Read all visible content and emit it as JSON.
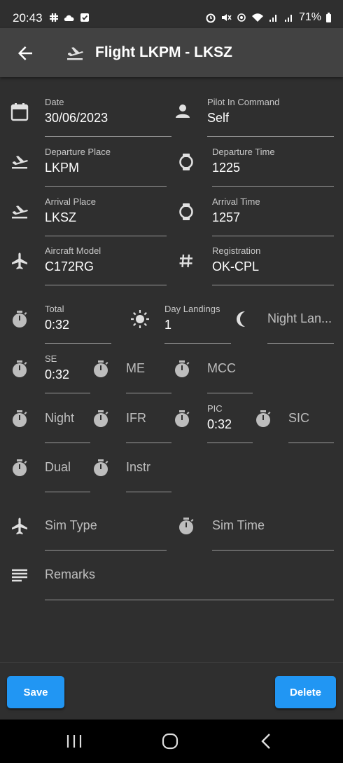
{
  "status_bar": {
    "time": "20:43",
    "battery": "71%"
  },
  "header": {
    "title": "Flight LKPM - LKSZ"
  },
  "fields": {
    "date": {
      "label": "Date",
      "value": "30/06/2023"
    },
    "pic_name": {
      "label": "Pilot In Command",
      "value": "Self"
    },
    "departure_place": {
      "label": "Departure Place",
      "value": "LKPM"
    },
    "departure_time": {
      "label": "Departure Time",
      "value": "1225"
    },
    "arrival_place": {
      "label": "Arrival Place",
      "value": "LKSZ"
    },
    "arrival_time": {
      "label": "Arrival Time",
      "value": "1257"
    },
    "aircraft_model": {
      "label": "Aircraft Model",
      "value": "C172RG"
    },
    "registration": {
      "label": "Registration",
      "value": "OK-CPL"
    },
    "total": {
      "label": "Total",
      "value": "0:32"
    },
    "day_landings": {
      "label": "Day Landings",
      "value": "1"
    },
    "night_landings": {
      "placeholder": "Night Lan..."
    },
    "se": {
      "label": "SE",
      "value": "0:32"
    },
    "me": {
      "placeholder": "ME"
    },
    "mcc": {
      "placeholder": "MCC"
    },
    "night": {
      "placeholder": "Night"
    },
    "ifr": {
      "placeholder": "IFR"
    },
    "pic": {
      "label": "PIC",
      "value": "0:32"
    },
    "sic": {
      "placeholder": "SIC"
    },
    "dual": {
      "placeholder": "Dual"
    },
    "instr": {
      "placeholder": "Instr"
    },
    "sim_type": {
      "placeholder": "Sim Type"
    },
    "sim_time": {
      "placeholder": "Sim Time"
    },
    "remarks": {
      "placeholder": "Remarks"
    }
  },
  "buttons": {
    "save": "Save",
    "delete": "Delete"
  },
  "colors": {
    "accent": "#2196f3",
    "background": "#2f2f2f",
    "appbar": "#424242"
  }
}
